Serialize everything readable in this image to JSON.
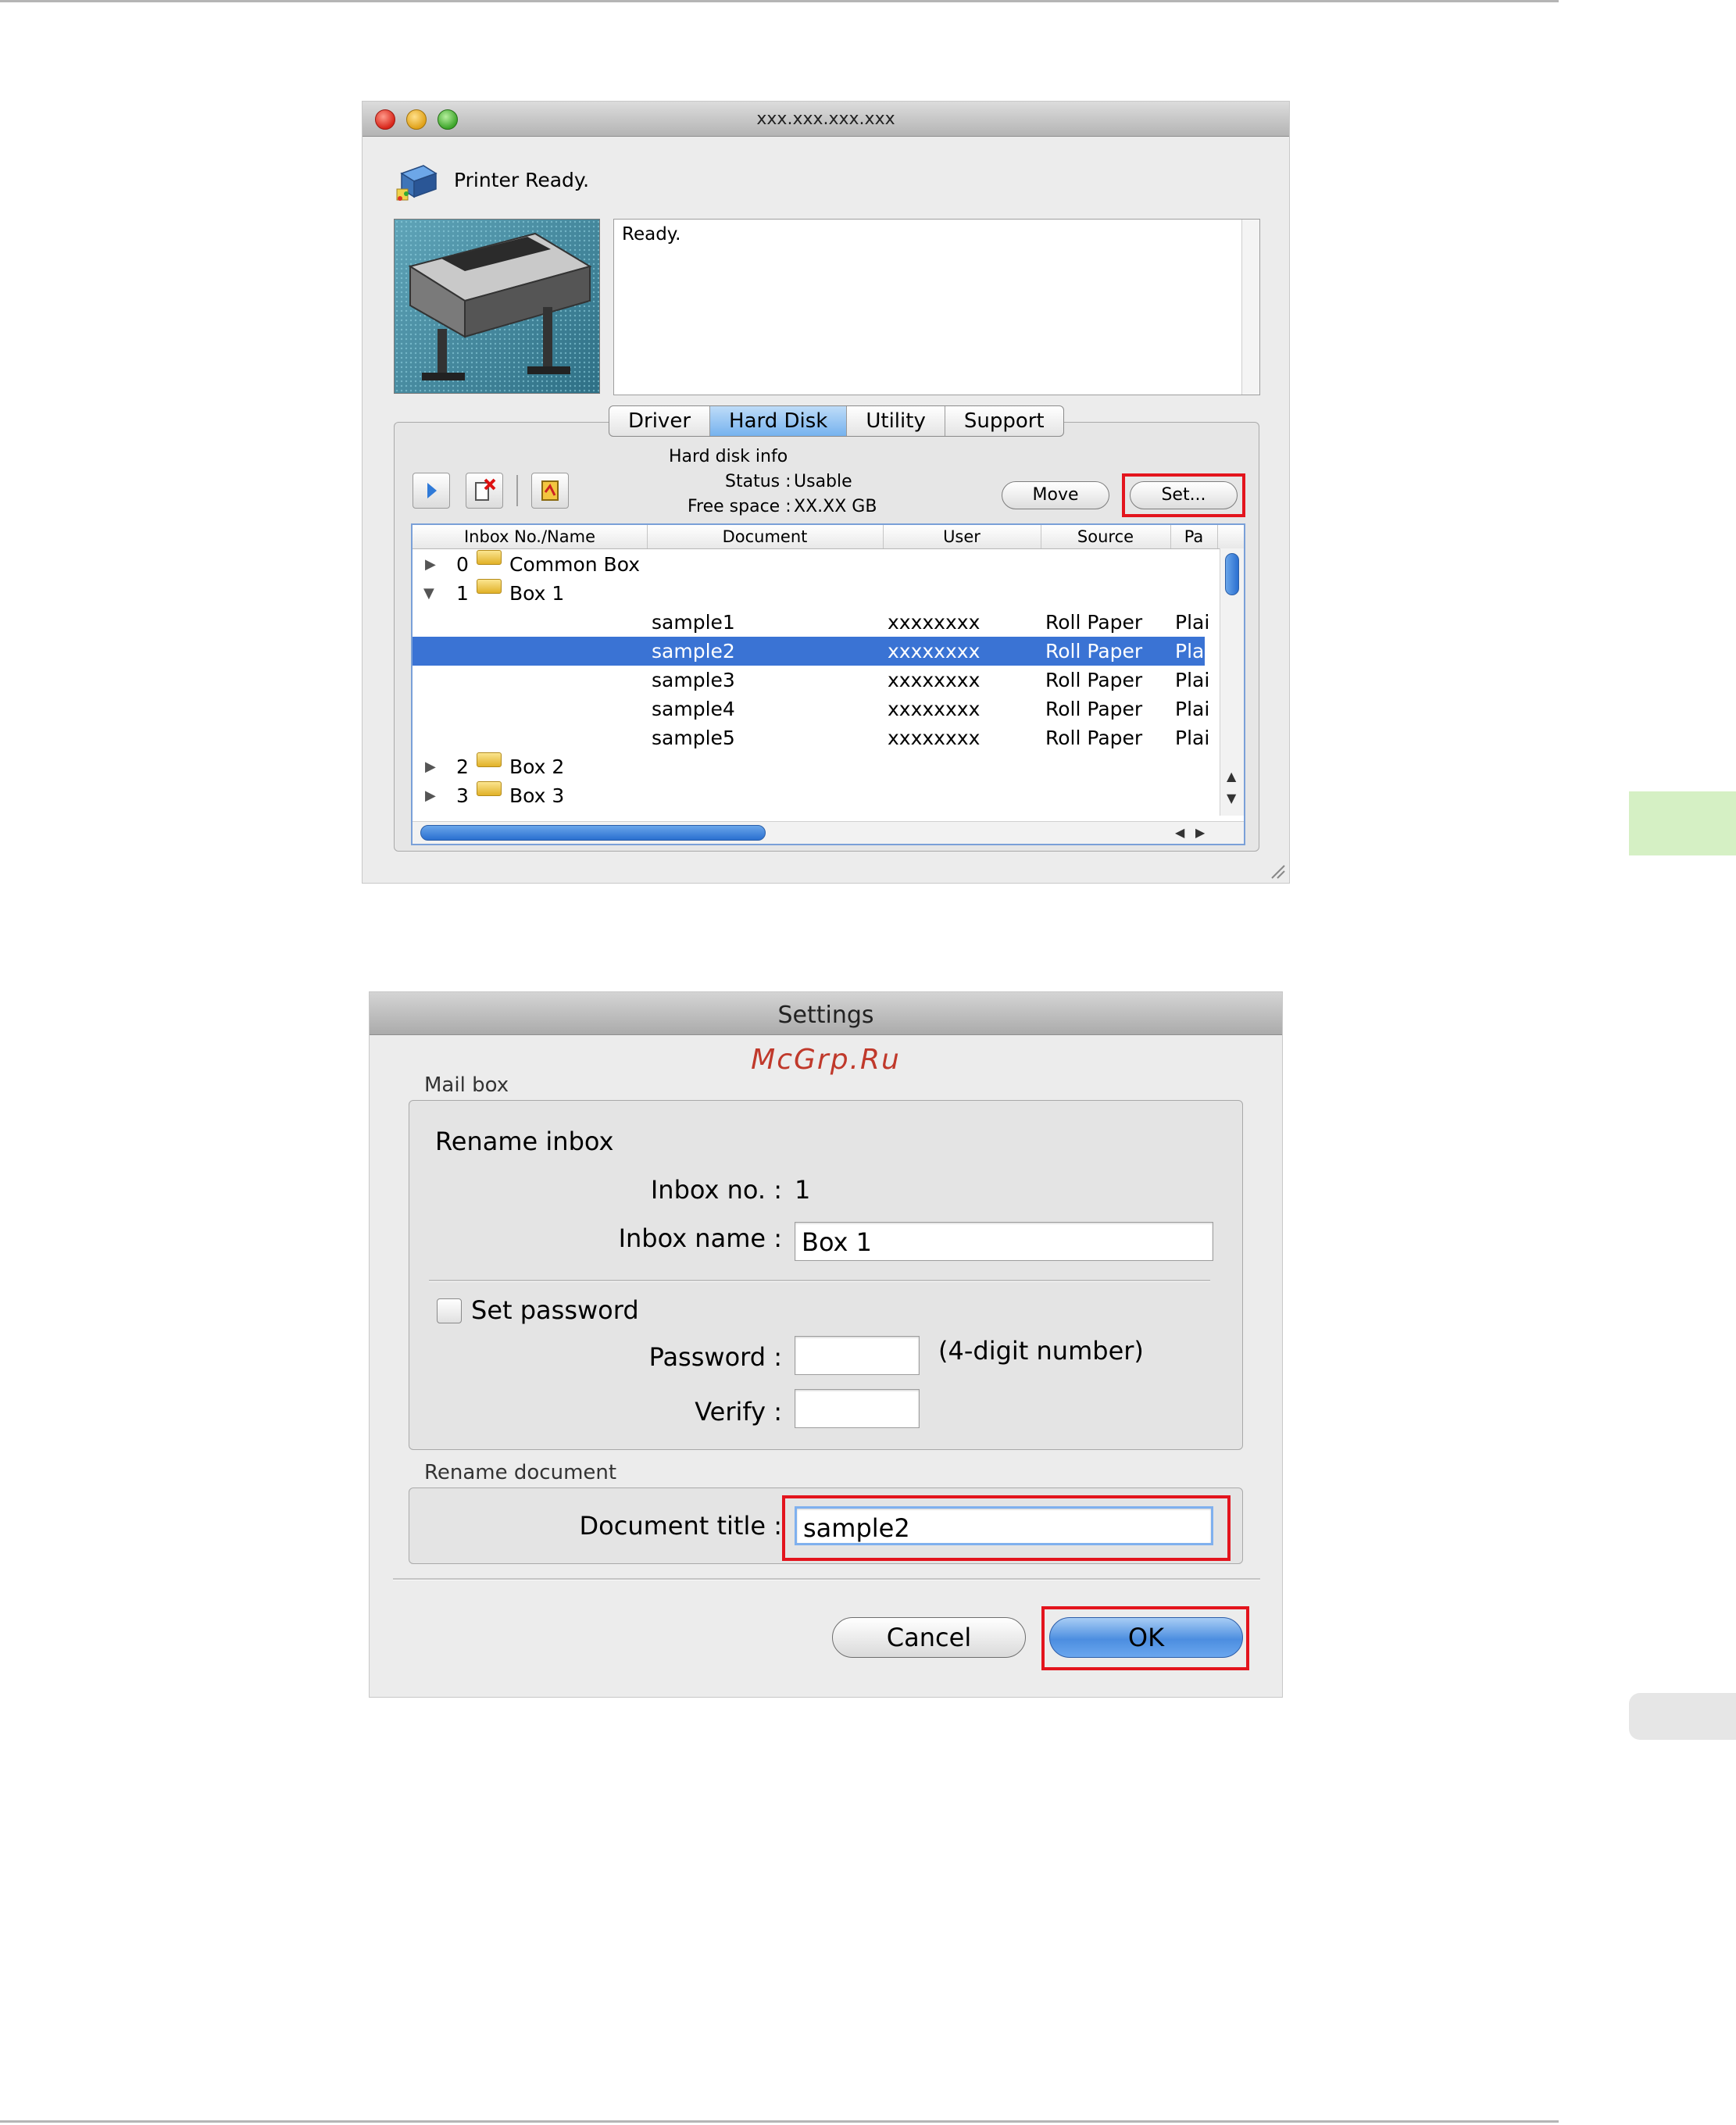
{
  "window1": {
    "title": "xxx.xxx.xxx.xxx",
    "status_title": "Printer Ready.",
    "status_message": "Ready.",
    "tabs": [
      {
        "label": "Driver"
      },
      {
        "label": "Hard Disk"
      },
      {
        "label": "Utility"
      },
      {
        "label": "Support"
      }
    ],
    "active_tab": "Hard Disk",
    "hard_disk_info": {
      "heading": "Hard disk info",
      "status_label": "Status :",
      "status_value": "Usable",
      "free_label": "Free space :",
      "free_value": "XX.XX GB"
    },
    "buttons": {
      "move": "Move",
      "set": "Set..."
    },
    "columns": [
      "Inbox No./Name",
      "Document",
      "User",
      "Source",
      "Pa"
    ],
    "boxes_top": [
      {
        "no": "0",
        "name": "Common Box",
        "expander": "▶"
      },
      {
        "no": "1",
        "name": "Box 1",
        "expander": "▼"
      }
    ],
    "documents": [
      {
        "name": "sample1",
        "user": "xxxxxxxx",
        "source": "Roll Paper",
        "paper": "Plai"
      },
      {
        "name": "sample2",
        "user": "xxxxxxxx",
        "source": "Roll Paper",
        "paper": "Plai"
      },
      {
        "name": "sample3",
        "user": "xxxxxxxx",
        "source": "Roll Paper",
        "paper": "Plai"
      },
      {
        "name": "sample4",
        "user": "xxxxxxxx",
        "source": "Roll Paper",
        "paper": "Plai"
      },
      {
        "name": "sample5",
        "user": "xxxxxxxx",
        "source": "Roll Paper",
        "paper": "Plai"
      }
    ],
    "selected_document": "sample2",
    "boxes_bottom": [
      {
        "no": "2",
        "name": "Box 2",
        "expander": "▶"
      },
      {
        "no": "3",
        "name": "Box 3",
        "expander": "▶"
      }
    ]
  },
  "window2": {
    "title": "Settings",
    "watermark": "McGrp.Ru",
    "mail_box_label": "Mail box",
    "rename_inbox": "Rename inbox",
    "inbox_no_label": "Inbox no. :",
    "inbox_no_value": "1",
    "inbox_name_label": "Inbox name :",
    "inbox_name_value": "Box 1",
    "set_password_label": "Set password",
    "password_label": "Password :",
    "password_hint": "(4-digit number)",
    "verify_label": "Verify :",
    "rename_document_label": "Rename document",
    "document_title_label": "Document title :",
    "document_title_value": "sample2",
    "cancel": "Cancel",
    "ok": "OK"
  },
  "colors": {
    "highlight": "#e3141d",
    "selection": "#3a73d4",
    "side_tab": "#d5f0c4"
  }
}
